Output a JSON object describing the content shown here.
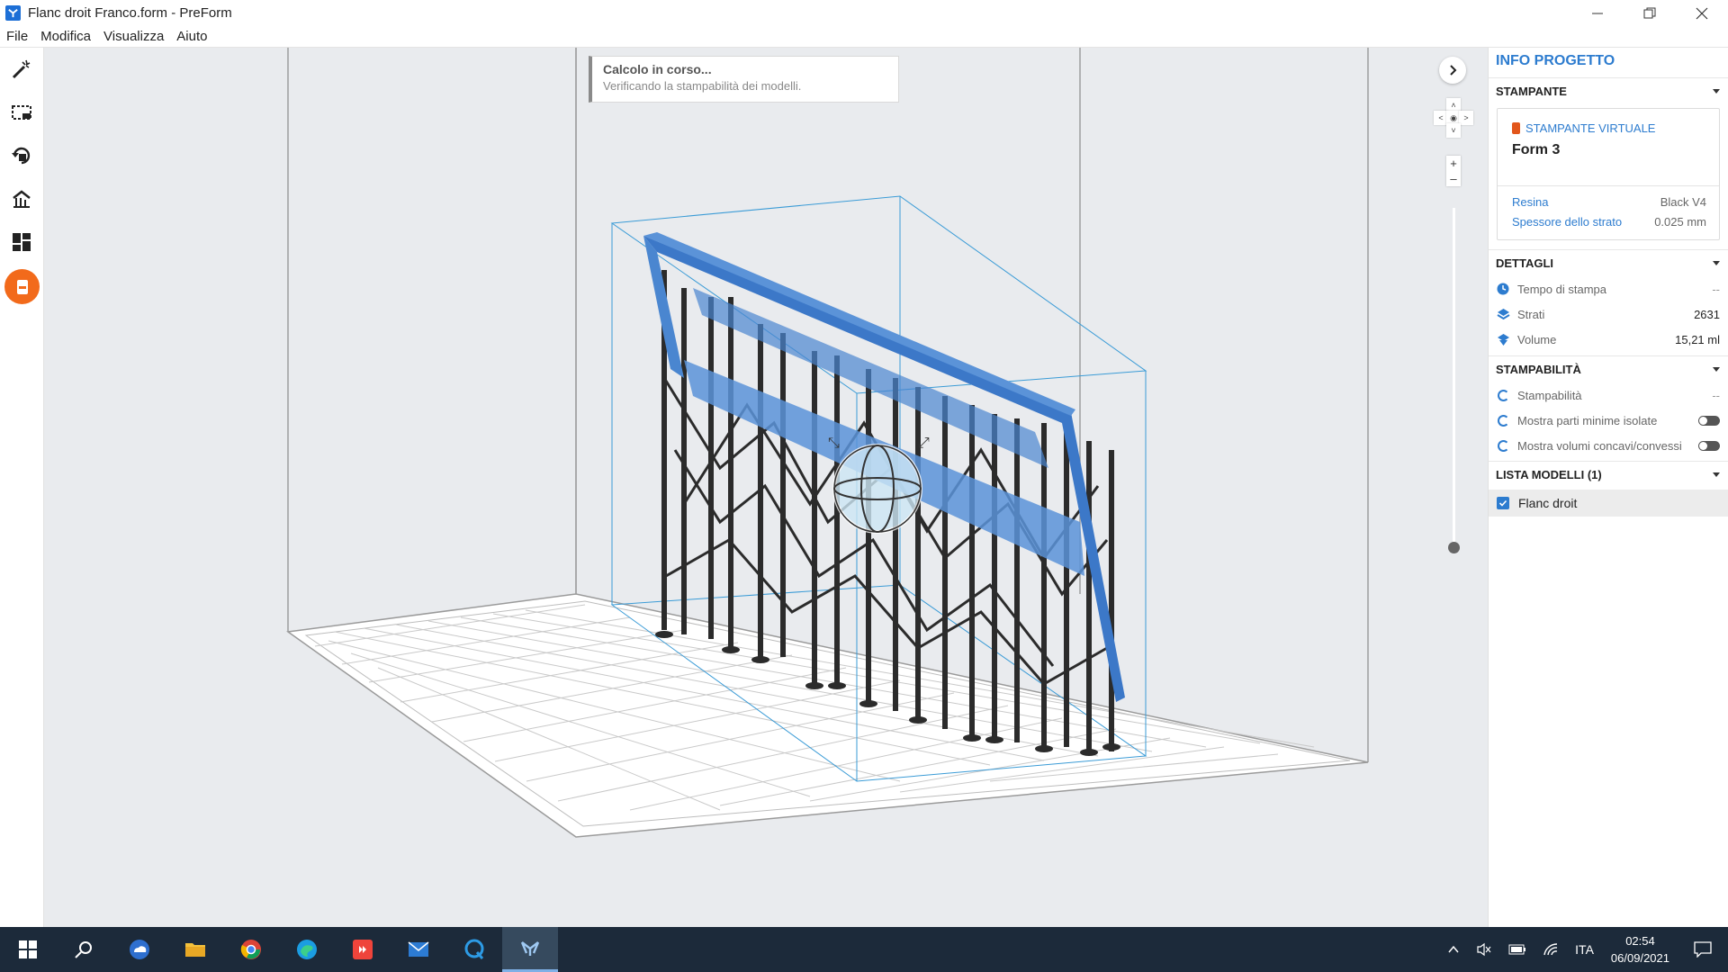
{
  "window": {
    "title": "Flanc droit Franco.form - PreForm"
  },
  "menu": {
    "items": [
      "File",
      "Modifica",
      "Visualizza",
      "Aiuto"
    ]
  },
  "toast": {
    "title": "Calcolo in corso...",
    "subtitle": "Verificando la stampabilità dei modelli."
  },
  "panel": {
    "header": "INFO PROGETTO",
    "printer_section": "STAMPANTE",
    "printer_type": "STAMPANTE VIRTUALE",
    "printer_name": "Form 3",
    "resin_label": "Resina",
    "resin_value": "Black V4",
    "layer_label": "Spessore dello strato",
    "layer_value": "0.025 mm",
    "details_section": "DETTAGLI",
    "print_time_label": "Tempo di stampa",
    "print_time_value": "--",
    "layers_label": "Strati",
    "layers_value": "2631",
    "volume_label": "Volume",
    "volume_value": "15,21 ml",
    "printability_section": "STAMPABILITÀ",
    "printability_label": "Stampabilità",
    "printability_value": "--",
    "min_parts_label": "Mostra parti minime isolate",
    "concave_label": "Mostra volumi concavi/convessi",
    "models_section": "LISTA MODELLI (1)",
    "model_name": "Flanc droit"
  },
  "taskbar": {
    "language": "ITA",
    "time": "02:54",
    "date": "06/09/2021"
  },
  "colors": {
    "accent": "#2d7ccf",
    "active_tool": "#f26a1b",
    "taskbar": "#1c2a3a",
    "model_blue": "#4a86d0",
    "supports": "#2b2b2b"
  }
}
